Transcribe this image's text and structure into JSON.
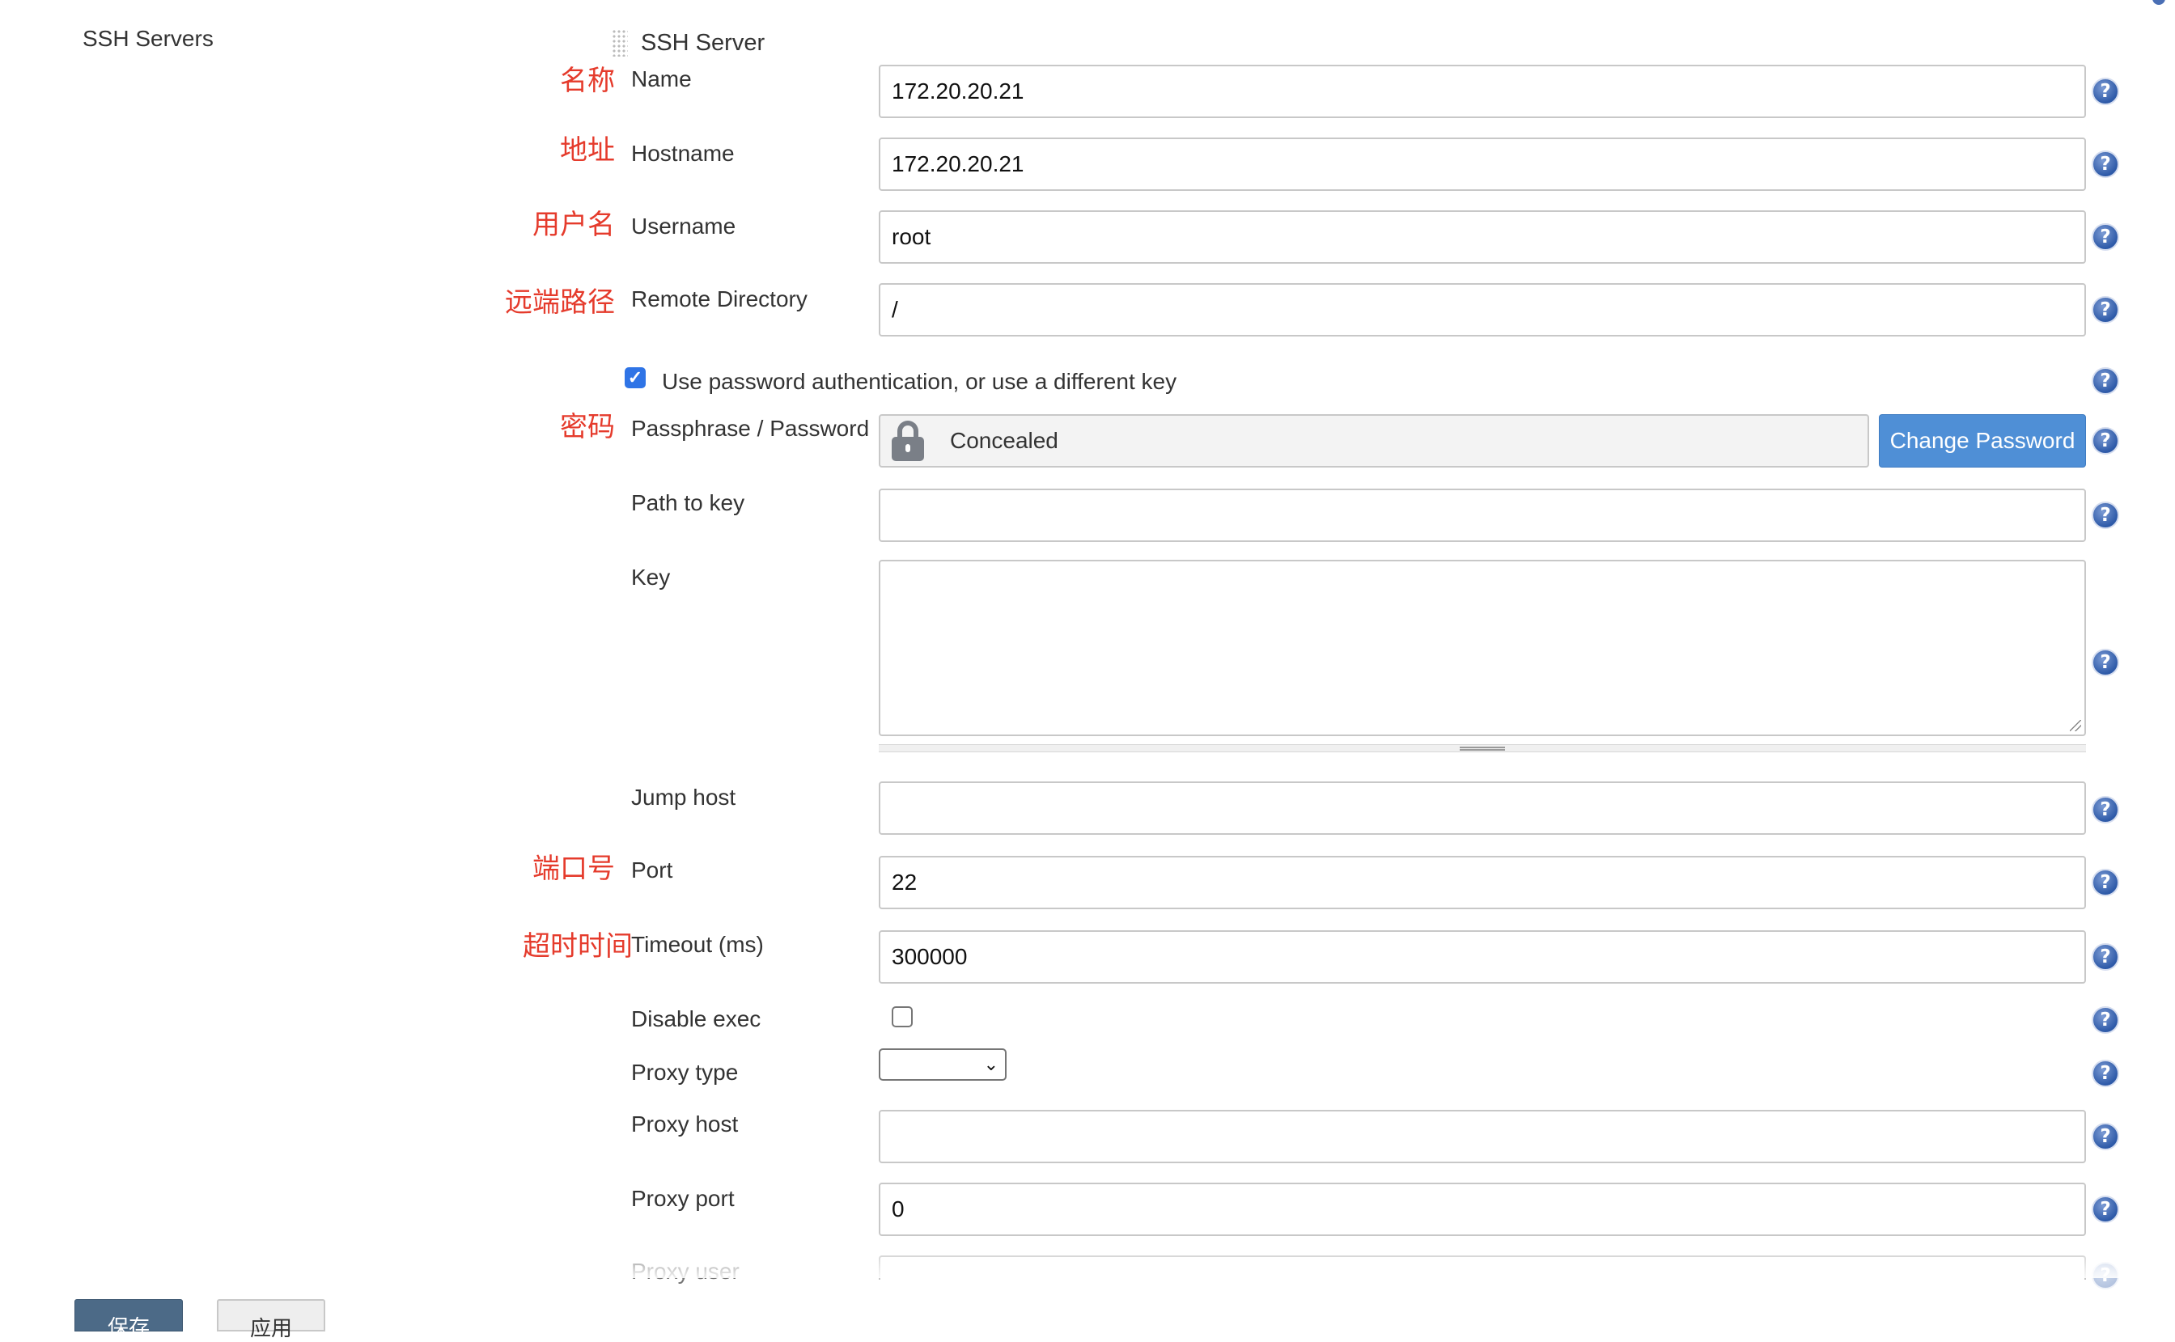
{
  "section": {
    "title": "SSH Servers"
  },
  "server": {
    "title": "SSH Server"
  },
  "fields": {
    "name": {
      "label": "Name",
      "value": "172.20.20.21",
      "annotation": "名称"
    },
    "hostname": {
      "label": "Hostname",
      "value": "172.20.20.21",
      "annotation": "地址"
    },
    "username": {
      "label": "Username",
      "value": "root",
      "annotation": "用户名"
    },
    "remote_dir": {
      "label": "Remote Directory",
      "value": "/",
      "annotation": "远端路径"
    },
    "use_password": {
      "label": "Use password authentication, or use a different key",
      "checked": true
    },
    "password": {
      "label": "Passphrase / Password",
      "value": "Concealed",
      "annotation": "密码",
      "button": "Change Password"
    },
    "path_to_key": {
      "label": "Path to key",
      "value": ""
    },
    "key": {
      "label": "Key",
      "value": ""
    },
    "jump_host": {
      "label": "Jump host",
      "value": ""
    },
    "port": {
      "label": "Port",
      "value": "22",
      "annotation": "端口号"
    },
    "timeout": {
      "label": "Timeout (ms)",
      "value": "300000",
      "annotation": "超时时间"
    },
    "disable_exec": {
      "label": "Disable exec",
      "checked": false
    },
    "proxy_type": {
      "label": "Proxy type",
      "value": ""
    },
    "proxy_host": {
      "label": "Proxy host",
      "value": ""
    },
    "proxy_port": {
      "label": "Proxy port",
      "value": "0"
    },
    "proxy_user": {
      "label": "Proxy user",
      "value": ""
    }
  },
  "help_icon": {
    "glyph": "?",
    "icon": "help-icon"
  },
  "buttons": {
    "save": "保存",
    "apply": "应用"
  },
  "colors": {
    "annotation": "#e53b2c",
    "primary_button": "#4f8fd6",
    "save_button": "#4c6a87",
    "checkbox": "#2f74e6"
  }
}
